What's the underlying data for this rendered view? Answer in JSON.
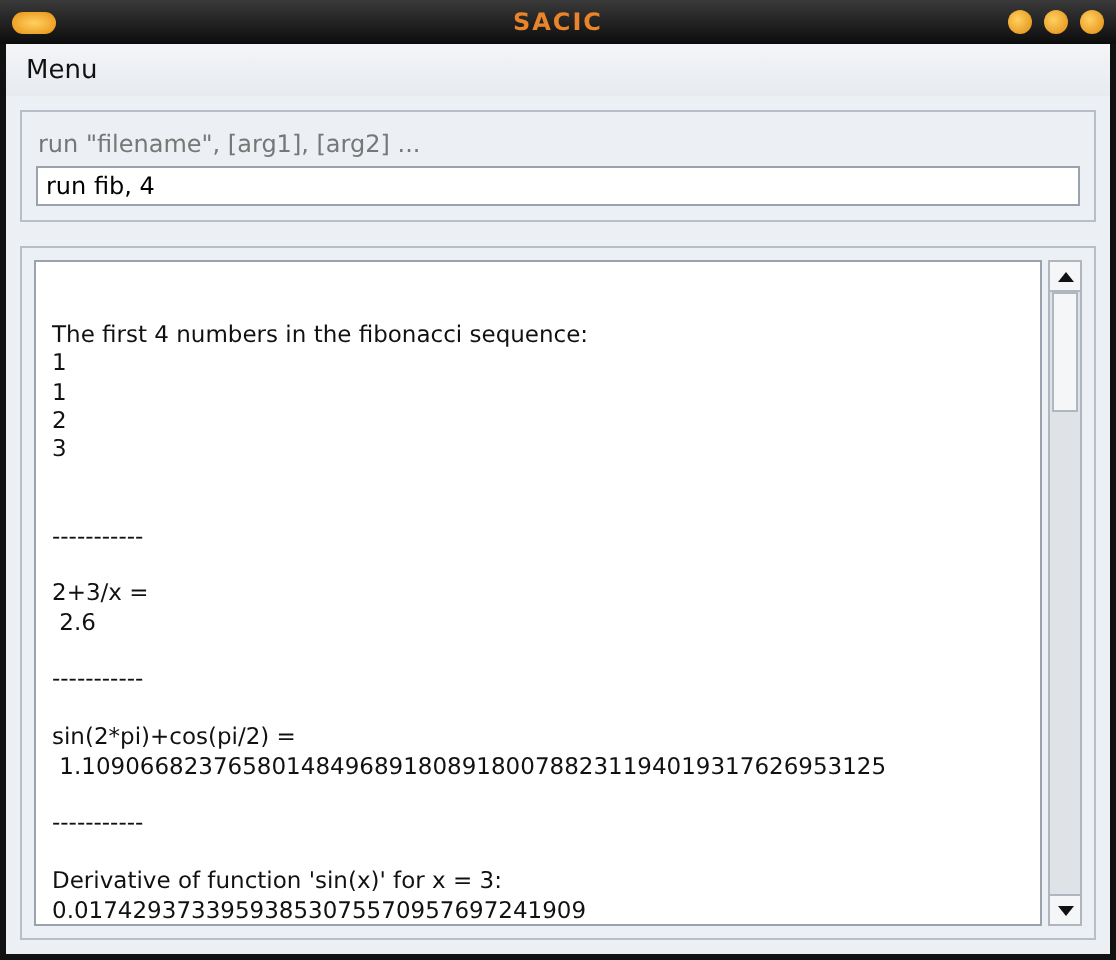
{
  "window": {
    "title": "SACIC"
  },
  "menu": [
    "Menu"
  ],
  "command": {
    "label": "run \"filename\", [arg1], [arg2] ...",
    "value": "run fib, 4"
  },
  "output": [
    {
      "kind": "blank"
    },
    {
      "kind": "blank"
    },
    {
      "kind": "text",
      "text": "The first 4 numbers in the fibonacci sequence:"
    },
    {
      "kind": "text",
      "text": "1"
    },
    {
      "kind": "text",
      "text": "1"
    },
    {
      "kind": "text",
      "text": "2"
    },
    {
      "kind": "text",
      "text": "3"
    },
    {
      "kind": "blank"
    },
    {
      "kind": "blank"
    },
    {
      "kind": "text",
      "text": "-----------"
    },
    {
      "kind": "blank"
    },
    {
      "kind": "text",
      "text": "2+3/x ="
    },
    {
      "kind": "text",
      "text": " 2.6"
    },
    {
      "kind": "blank"
    },
    {
      "kind": "text",
      "text": "-----------"
    },
    {
      "kind": "blank"
    },
    {
      "kind": "text",
      "text": "sin(2*pi)+cos(pi/2) ="
    },
    {
      "kind": "text",
      "text": " 1.1090668237658014849689180891800788231194019317626953125"
    },
    {
      "kind": "blank"
    },
    {
      "kind": "text",
      "text": "-----------"
    },
    {
      "kind": "blank"
    },
    {
      "kind": "text",
      "text": "Derivative of function 'sin(x)' for x = 3:"
    },
    {
      "kind": "text",
      "text": "0.01742937339593853075570957697241909"
    }
  ]
}
